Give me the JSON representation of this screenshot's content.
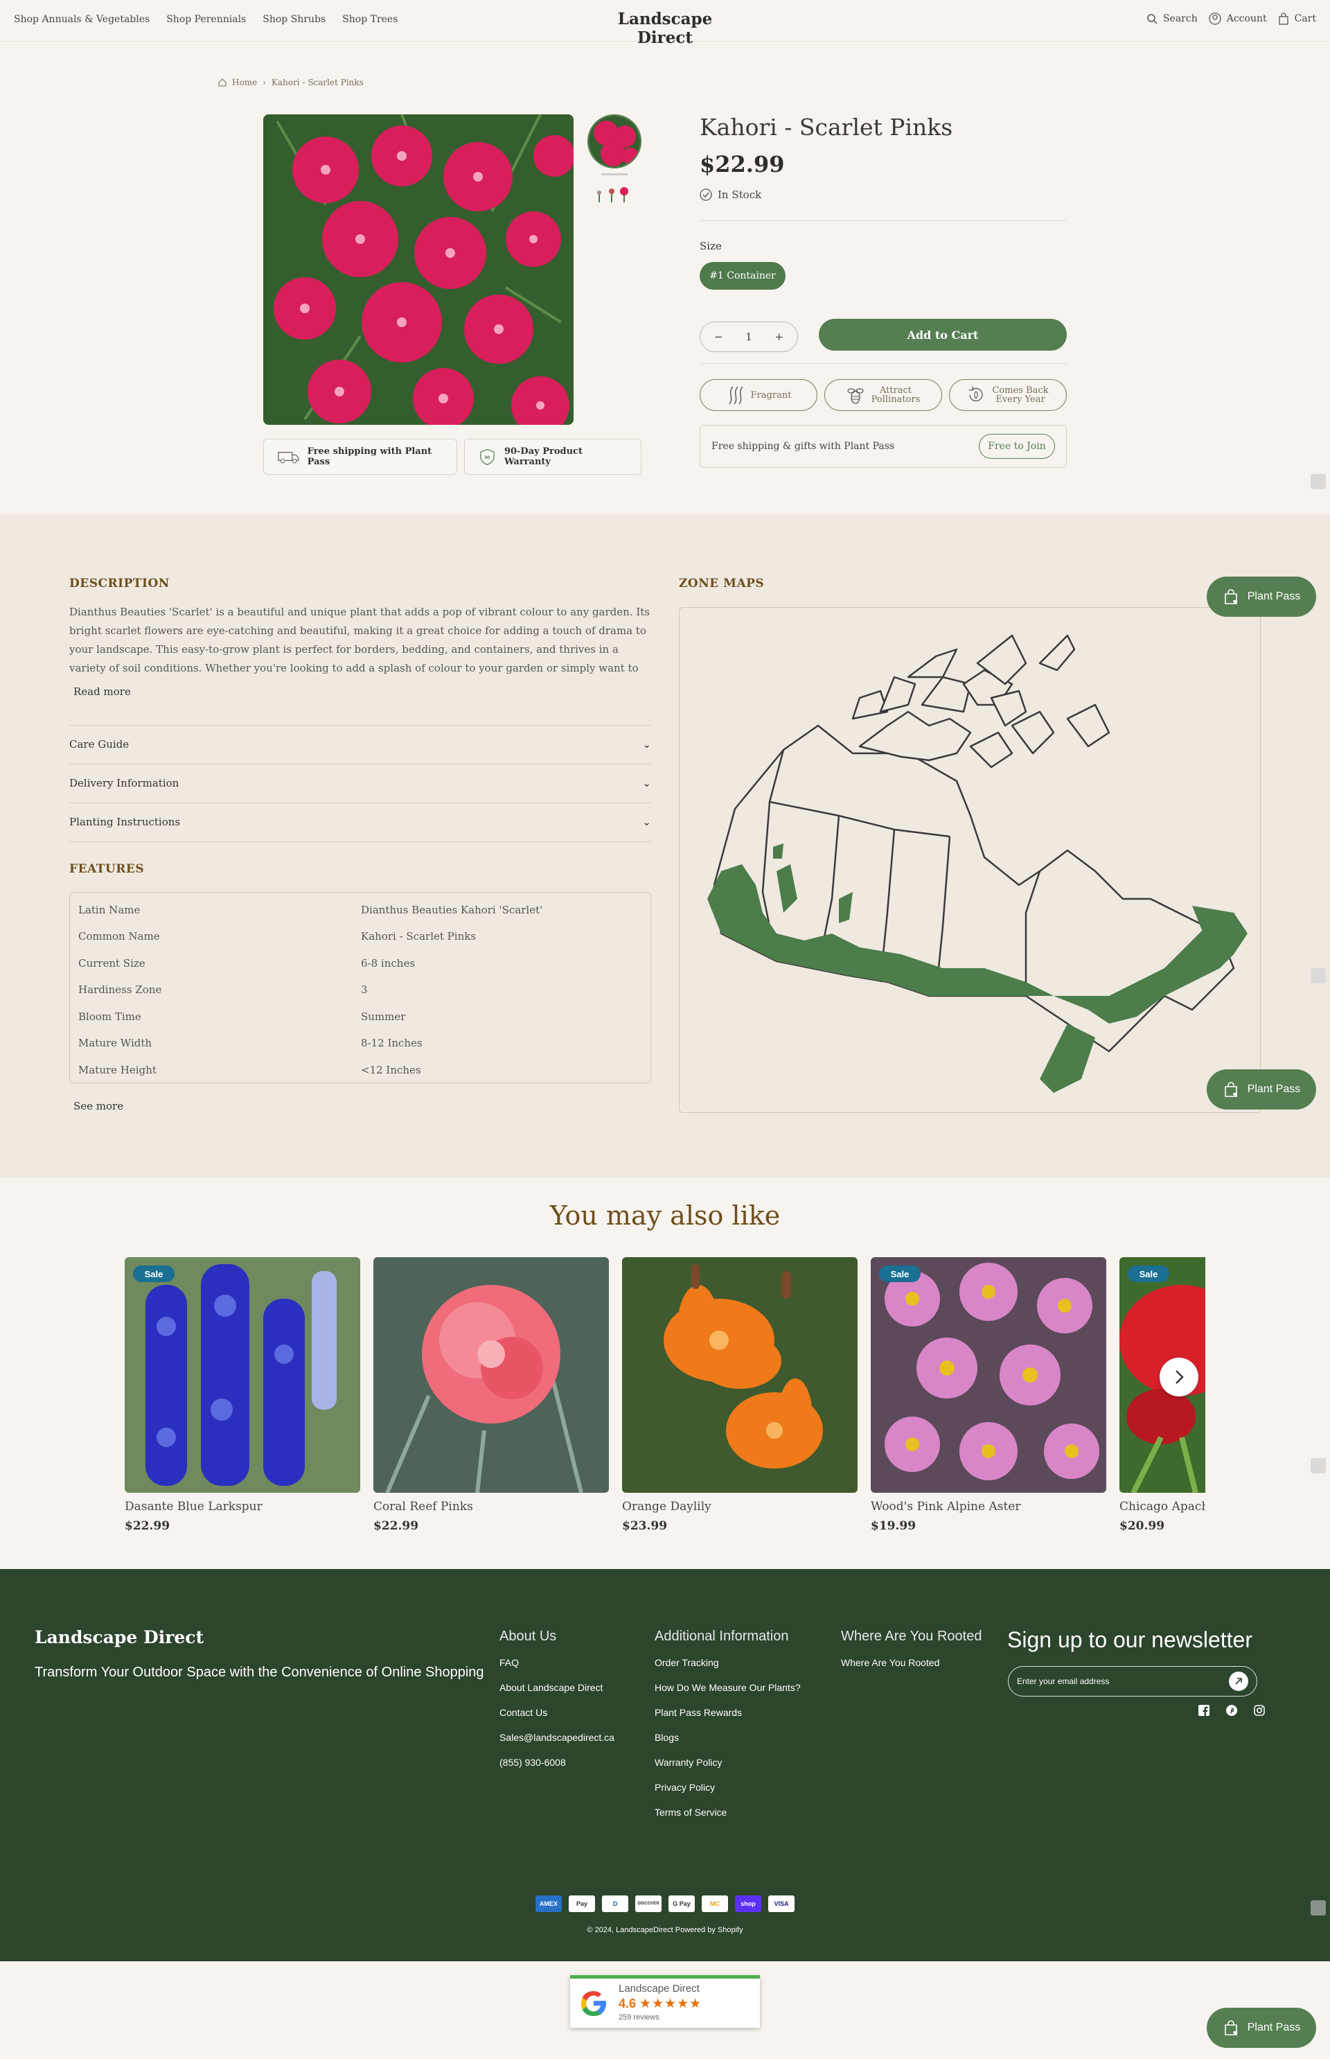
{
  "header": {
    "nav": [
      "Shop Annuals & Vegetables",
      "Shop Perennials",
      "Shop Shrubs",
      "Shop Trees"
    ],
    "brand": "Landscape Direct",
    "search": "Search",
    "account": "Account",
    "cart": "Cart"
  },
  "breadcrumb": {
    "home": "Home",
    "current": "Kahori - Scarlet Pinks"
  },
  "product": {
    "title": "Kahori - Scarlet Pinks",
    "price": "$22.99",
    "stock": "In Stock",
    "size_label": "Size",
    "size_option": "#1 Container",
    "quantity": "1",
    "minus": "−",
    "plus": "+",
    "add_to_cart": "Add to Cart",
    "features": [
      {
        "label": "Fragrant",
        "icon": "wave-icon"
      },
      {
        "label1": "Attract",
        "label2": "Pollinators",
        "icon": "bee-icon"
      },
      {
        "label1": "Comes Back",
        "label2": "Every Year",
        "icon": "regrow-icon"
      }
    ],
    "plant_pass_text": "Free shipping & gifts with Plant Pass",
    "free_to_join": "Free to Join",
    "shipping_pill": "Free shipping with Plant Pass",
    "warranty_pill": "90-Day Product Warranty"
  },
  "info": {
    "description_heading": "DESCRIPTION",
    "description": "Dianthus Beauties 'Scarlet' is a beautiful and unique plant that adds a pop of vibrant colour to any garden. Its bright scarlet flowers are eye-catching and beautiful, making it a great choice for adding a touch of drama to your landscape. This easy-to-grow plant is perfect for borders, bedding, and containers, and thrives in a variety of soil conditions. Whether you're looking to add a splash of colour to your garden or simply want to brighten up",
    "read_more": "Read more",
    "accordions": [
      "Care Guide",
      "Delivery Information",
      "Planting Instructions"
    ],
    "features_heading": "FEATURES",
    "features": [
      {
        "k": "Latin Name",
        "v": "Dianthus Beauties Kahori 'Scarlet'"
      },
      {
        "k": "Common Name",
        "v": "Kahori - Scarlet Pinks"
      },
      {
        "k": "Current Size",
        "v": "6-8 inches"
      },
      {
        "k": "Hardiness Zone",
        "v": "3"
      },
      {
        "k": "Bloom Time",
        "v": "Summer"
      },
      {
        "k": "Mature Width",
        "v": "8-12 Inches"
      },
      {
        "k": "Mature Height",
        "v": "<12 Inches"
      }
    ],
    "see_more": "See more",
    "zone_maps_heading": "ZONE MAPS",
    "plant_pass_button": "Plant Pass"
  },
  "related": {
    "title": "You may also like",
    "sale_badge": "Sale",
    "items": [
      {
        "name": "Dasante Blue Larkspur",
        "price": "$22.99"
      },
      {
        "name": "Coral Reef Pinks",
        "price": "$22.99"
      },
      {
        "name": "Orange Daylily",
        "price": "$23.99"
      },
      {
        "name": "Wood's Pink Alpine Aster",
        "price": "$19.99"
      },
      {
        "name": "Chicago Apache",
        "price": "$20.99"
      }
    ]
  },
  "footer": {
    "brand": "Landscape Direct",
    "tagline": "Transform Your Outdoor Space with the Convenience of Online Shopping",
    "about": {
      "heading": "About Us",
      "links": [
        "FAQ",
        "About Landscape Direct",
        "Contact Us",
        "Sales@landscapedirect.ca",
        "(855) 930-6008"
      ]
    },
    "additional": {
      "heading": "Additional Information",
      "links": [
        "Order Tracking",
        "How Do We Measure Our Plants?",
        "Plant Pass Rewards",
        "Blogs",
        "Warranty Policy",
        "Privacy Policy",
        "Terms of Service"
      ]
    },
    "rooted": {
      "heading": "Where Are You Rooted",
      "links": [
        "Where Are You Rooted"
      ]
    },
    "newsletter_heading": "Sign up to our newsletter",
    "email_placeholder": "Enter your email address",
    "payments": [
      "AMEX",
      "Pay",
      "D",
      "DISCOVER",
      "G Pay",
      "MC",
      "shop",
      "VISA"
    ],
    "copyright": "© 2024, LandscapeDirect Powered by Shopify"
  },
  "google": {
    "name": "Landscape Direct",
    "rating": "4.6",
    "reviews": "259 reviews",
    "stars": "★★★★★"
  }
}
